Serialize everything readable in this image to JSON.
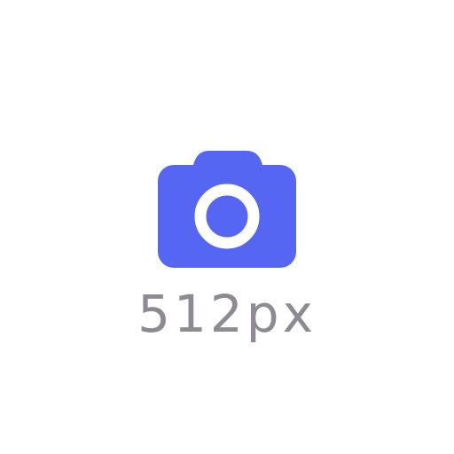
{
  "icon": {
    "name": "camera-icon",
    "color": "#5566f2",
    "lens_color": "#ffffff"
  },
  "caption": {
    "text": "512px",
    "color": "#8e8a93"
  }
}
